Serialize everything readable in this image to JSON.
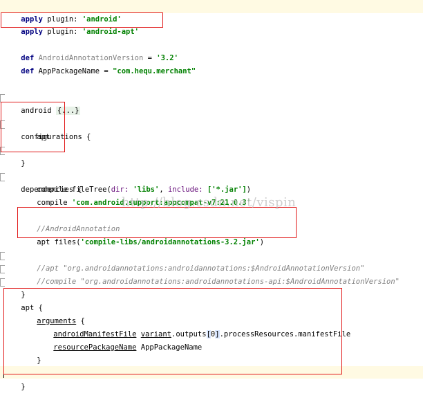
{
  "code": {
    "apply1": {
      "kw": "apply",
      "sep": " plugin: ",
      "val": "'android'"
    },
    "apply2": {
      "kw": "apply",
      "sep": " plugin: ",
      "val": "'android-apt'"
    },
    "def1": {
      "kw": "def",
      "name": " AndroidAnnotationVersion",
      "eq": " = ",
      "val": "'3.2'"
    },
    "def2": {
      "kw": "def",
      "name": " AppPackageName",
      "eq": " = ",
      "val": "\"com.hequ.merchant\""
    },
    "android": {
      "name": "android ",
      "folded": "{...}"
    },
    "configurations": {
      "open": "configurations {",
      "item": "apt",
      "close": "}"
    },
    "dependencies": {
      "open": "dependencies {",
      "line1": {
        "fn": "compile ",
        "call": "fileTree(",
        "p1": "dir: ",
        "v1": "'libs'",
        "sep": ", ",
        "p2": "include: ",
        "v2": "['*.jar']",
        "end": ")"
      },
      "line2": {
        "fn": "compile ",
        "val": "'com.android.support:appcompat-v7:21.0.3'"
      },
      "comment": "//AndroidAnnotation",
      "line3": {
        "fn": "apt ",
        "call": "files(",
        "val": "'compile-libs/androidannotations-3.2.jar'",
        "end": ")"
      },
      "cmt1": "//apt \"org.androidannotations:androidannotations:$AndroidAnnotationVersion\"",
      "cmt2": "//compile \"org.androidannotations:androidannotations-api:$AndroidAnnotationVersion\"",
      "close": "}"
    },
    "apt": {
      "open": "apt {",
      "arguments": "arguments",
      "brace": " {",
      "line1": {
        "key": "androidManifestFile",
        "sp": " ",
        "obj": "variant",
        "rest": ".outputs",
        "bopen": "[",
        "idx": "0",
        "bclose": "]",
        "tail": ".processResources.manifestFile"
      },
      "line2": {
        "key": "resourcePackageName",
        "val": " AppPackageName"
      },
      "inner_close": "}",
      "close": "}"
    }
  },
  "watermark": "http://blog.csdn.net/vispin"
}
